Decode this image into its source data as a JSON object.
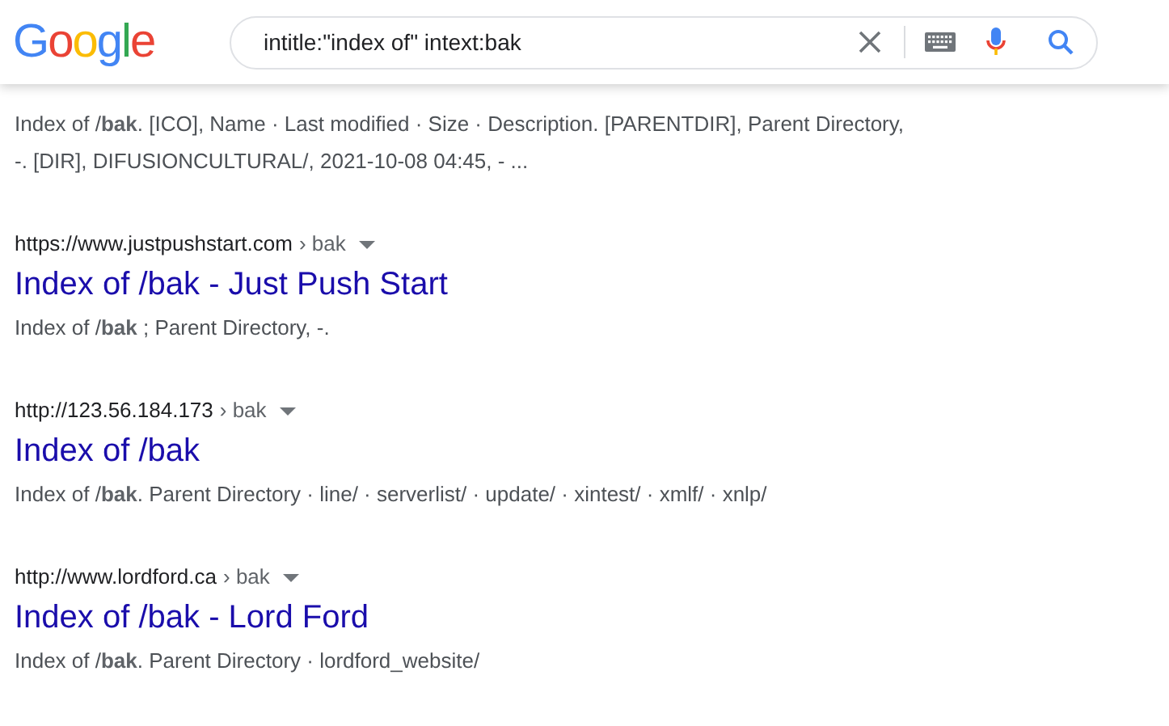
{
  "header": {
    "logo": [
      {
        "letter": "G",
        "color": "#4285f4"
      },
      {
        "letter": "o",
        "color": "#ea4335"
      },
      {
        "letter": "o",
        "color": "#fbbc05"
      },
      {
        "letter": "g",
        "color": "#4285f4"
      },
      {
        "letter": "l",
        "color": "#34a853"
      },
      {
        "letter": "e",
        "color": "#ea4335"
      }
    ],
    "search": {
      "value": "intitle:\"index of\" intext:bak"
    }
  },
  "results": [
    {
      "snippet": [
        "Index of /**bak**. [ICO], Name · Last modified · Size · Description. [PARENTDIR], Parent Directory,",
        "-. [DIR], DIFUSIONCULTURAL/, 2021-10-08 04:45, - ..."
      ]
    },
    {
      "url": "https://www.justpushstart.com",
      "path": "› bak",
      "title": "Index of /bak - Just Push Start",
      "snippet": [
        "Index of /**bak** ; Parent Directory, -."
      ]
    },
    {
      "url": "http://123.56.184.173",
      "path": "› bak",
      "title": "Index of /bak",
      "snippet": [
        "Index of /**bak**. Parent Directory · line/ · serverlist/ · update/ · xintest/ · xmlf/ · xnlp/"
      ]
    },
    {
      "url": "http://www.lordford.ca",
      "path": "› bak",
      "title": "Index of /bak - Lord Ford",
      "snippet": [
        "Index of /**bak**. Parent Directory · lordford_website/"
      ]
    }
  ]
}
